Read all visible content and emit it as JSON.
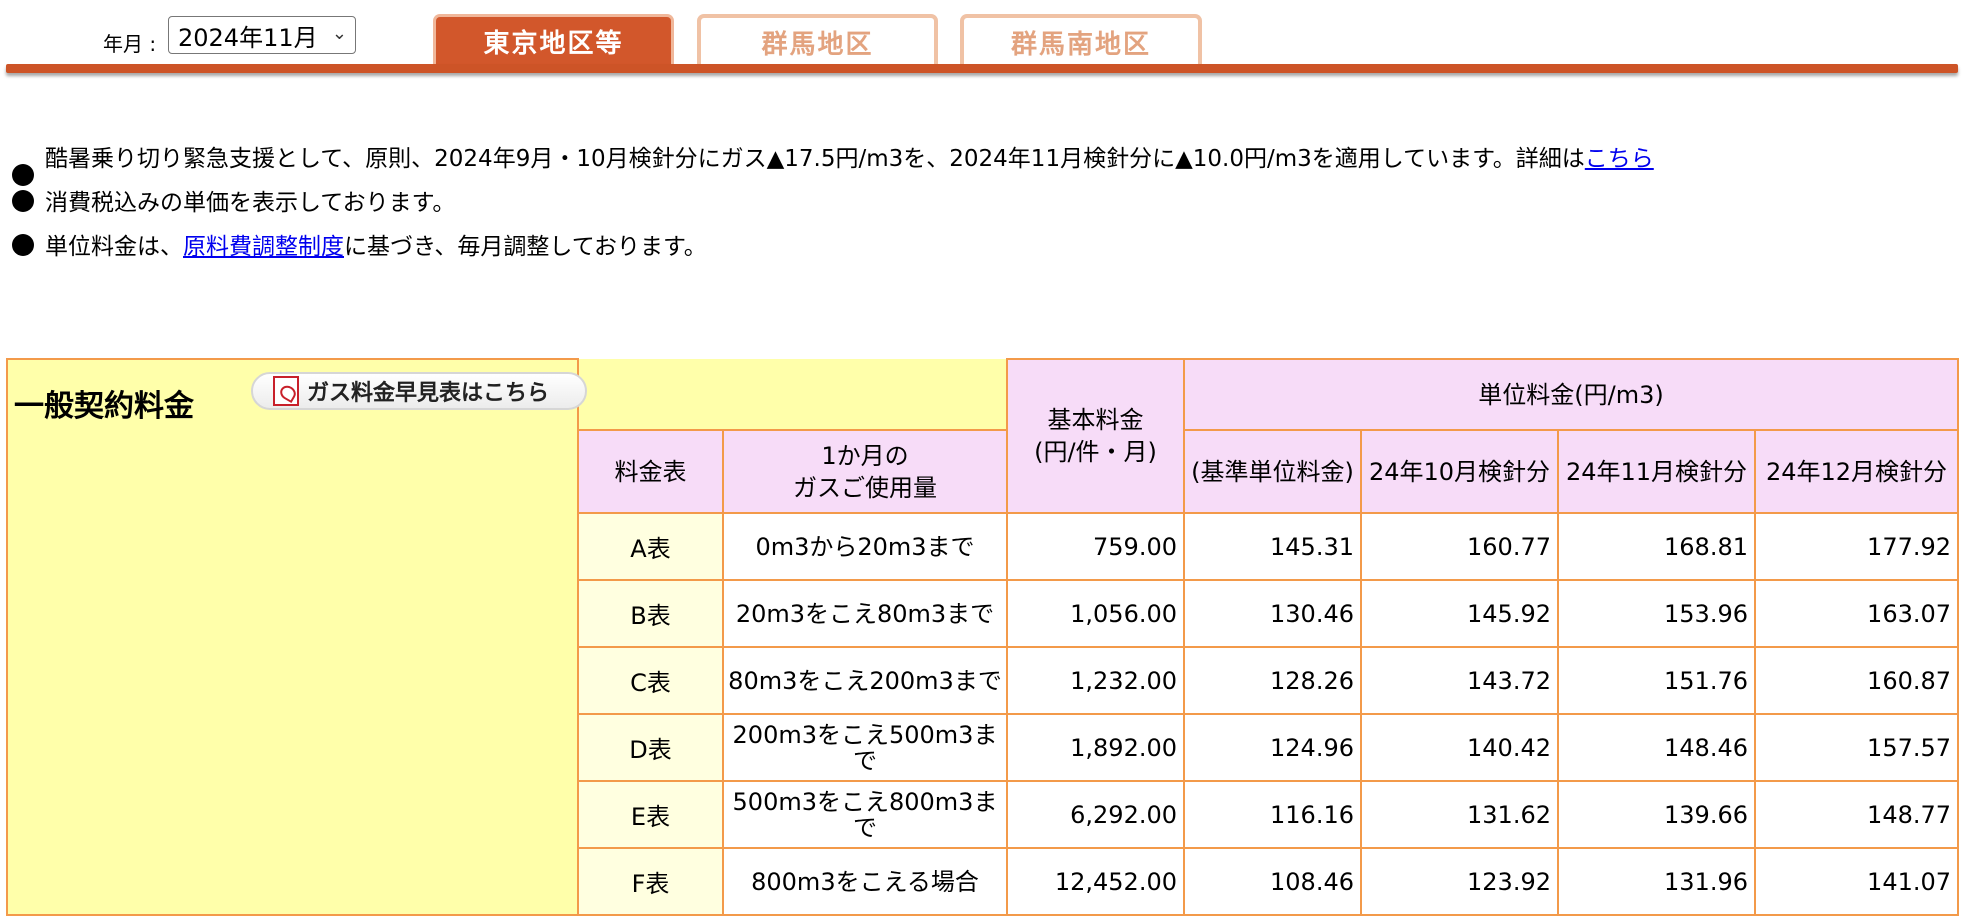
{
  "header": {
    "month_label": "年月 :",
    "month_value": "2024年11月",
    "tabs": [
      {
        "label": "東京地区等",
        "active": true
      },
      {
        "label": "群馬地区",
        "active": false
      },
      {
        "label": "群馬南地区",
        "active": false
      }
    ]
  },
  "notes": {
    "note1_text": "酷暑乗り切り緊急支援として、原則、2024年9月・10月検針分にガス▲17.5円/m3を、2024年11月検針分に▲10.0円/m3を適用しています。詳細は",
    "note1_link": "こちら",
    "note2_text": "消費税込みの単価を表示しております。",
    "note3_prefix": "単位料金は、",
    "note3_link": "原料費調整制度",
    "note3_suffix": "に基づき、毎月調整しております。"
  },
  "table": {
    "title": "一般契約料金",
    "pdf_link_label": "ガス料金早見表はこちら",
    "col_headers": {
      "rate_table": "料金表",
      "usage_line1": "1か月の",
      "usage_line2": "ガスご使用量",
      "basic_fee_line1": "基本料金",
      "basic_fee_line2": "(円/件・月)",
      "unit_fee_group": "単位料金(円/m3)",
      "base_unit": "(基準単位料金)",
      "oct": "24年10月検針分",
      "nov": "24年11月検針分",
      "dec": "24年12月検針分"
    },
    "rows": [
      {
        "table": "A表",
        "usage": "0m3から20m3まで",
        "basic": "759.00",
        "base": "145.31",
        "oct": "160.77",
        "nov": "168.81",
        "dec": "177.92"
      },
      {
        "table": "B表",
        "usage": "20m3をこえ80m3まで",
        "basic": "1,056.00",
        "base": "130.46",
        "oct": "145.92",
        "nov": "153.96",
        "dec": "163.07"
      },
      {
        "table": "C表",
        "usage": "80m3をこえ200m3まで",
        "basic": "1,232.00",
        "base": "128.26",
        "oct": "143.72",
        "nov": "151.76",
        "dec": "160.87"
      },
      {
        "table": "D表",
        "usage": "200m3をこえ500m3まで",
        "basic": "1,892.00",
        "base": "124.96",
        "oct": "140.42",
        "nov": "148.46",
        "dec": "157.57"
      },
      {
        "table": "E表",
        "usage": "500m3をこえ800m3まで",
        "basic": "6,292.00",
        "base": "116.16",
        "oct": "131.62",
        "nov": "139.66",
        "dec": "148.77"
      },
      {
        "table": "F表",
        "usage": "800m3をこえる場合",
        "basic": "12,452.00",
        "base": "108.46",
        "oct": "123.92",
        "nov": "131.96",
        "dec": "141.07"
      }
    ]
  },
  "colors": {
    "tab_active": "#d2572b",
    "tab_inactive_text": "#e3a37f",
    "table_border": "#f39a4a",
    "header_pink": "#f7dcf8",
    "title_yellow": "#ffffaa",
    "rate_cell_yellow": "#ffffe0",
    "link": "#0000ee"
  },
  "icons": {
    "select_chevron": "chevron-down-icon",
    "bullet": "bullet-icon",
    "pdf": "pdf-icon"
  }
}
